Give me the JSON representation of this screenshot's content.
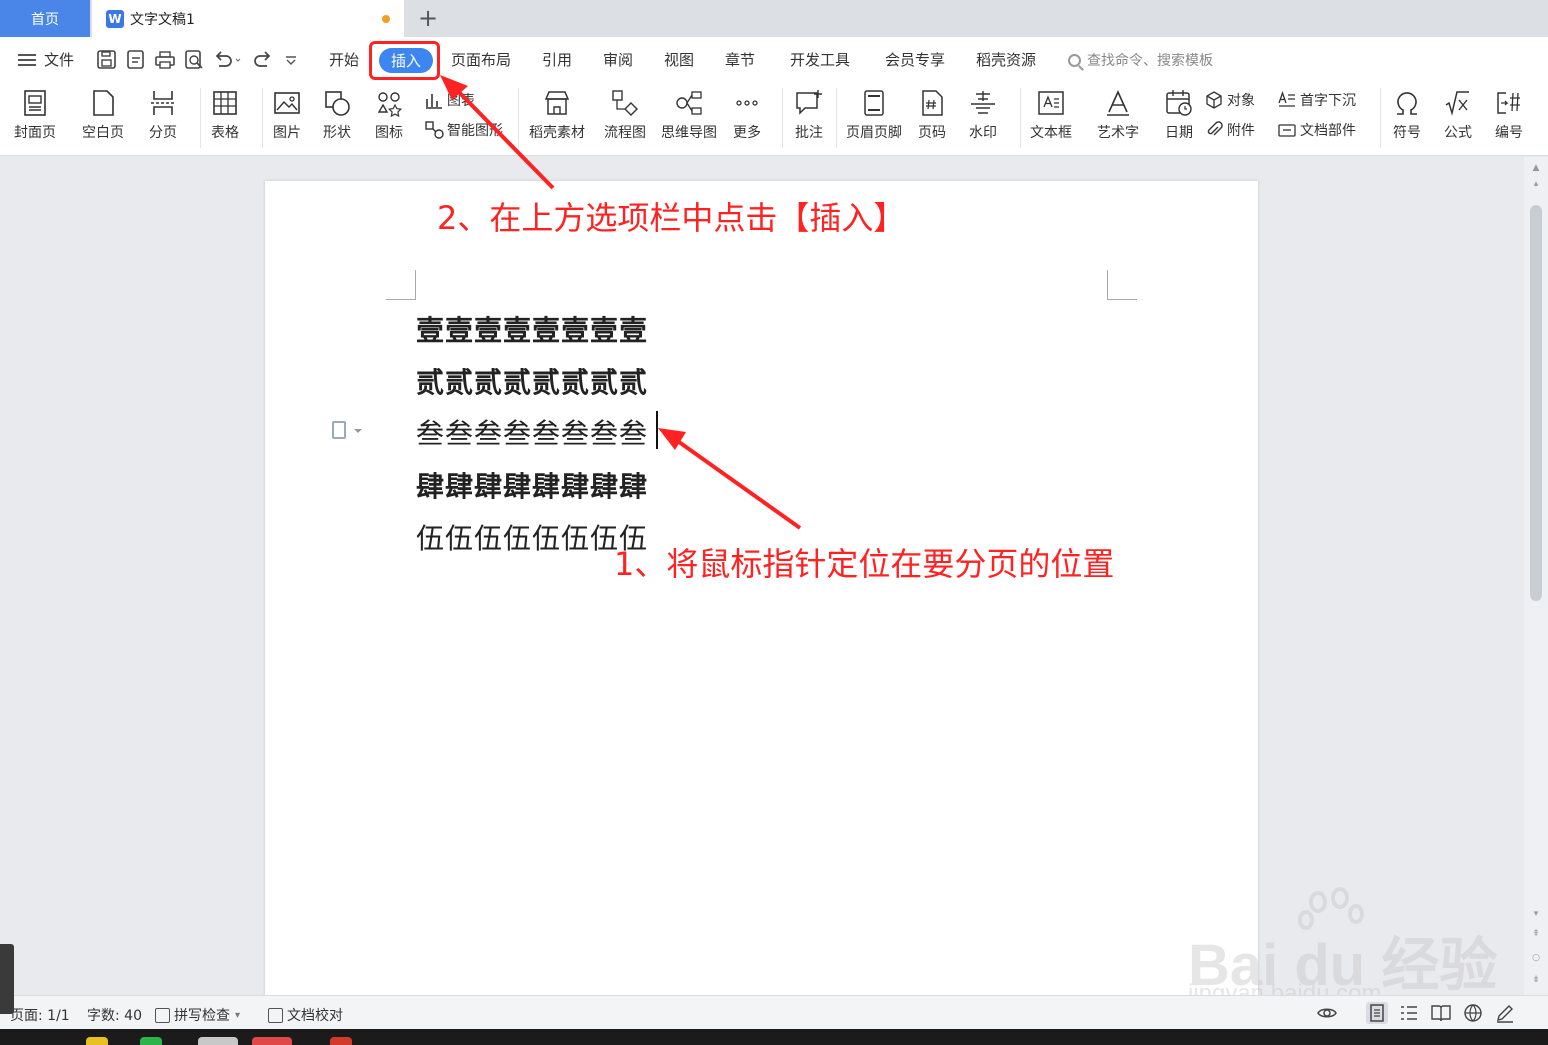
{
  "tabs": {
    "home": "首页",
    "doc": "文字文稿1",
    "add": "+"
  },
  "menu": {
    "file": "文件",
    "tabs": [
      "开始",
      "插入",
      "页面布局",
      "引用",
      "审阅",
      "视图",
      "章节",
      "开发工具",
      "会员专享",
      "稻壳资源"
    ],
    "search_placeholder": "查找命令、搜索模板"
  },
  "ribbon": {
    "cover": "封面页",
    "blank": "空白页",
    "pagebreak": "分页",
    "table": "表格",
    "picture": "图片",
    "shape": "形状",
    "icon": "图标",
    "chart": "图表",
    "smartart": "智能图形",
    "docer": "稻壳素材",
    "flowchart": "流程图",
    "mindmap": "思维导图",
    "more": "更多",
    "comment": "批注",
    "header_footer": "页眉页脚",
    "page_number": "页码",
    "watermark": "水印",
    "textbox": "文本框",
    "wordart": "艺术字",
    "date": "日期",
    "object": "对象",
    "attachment": "附件",
    "dropcap": "首字下沉",
    "docpart": "文档部件",
    "symbol": "符号",
    "formula": "公式",
    "numbering": "编号"
  },
  "document": {
    "lines": [
      "壹壹壹壹壹壹壹壹",
      "贰贰贰贰贰贰贰贰",
      "叁叁叁叁叁叁叁叁",
      "肆肆肆肆肆肆肆肆",
      "伍伍伍伍伍伍伍伍"
    ]
  },
  "annotations": {
    "step2": "2、在上方选项栏中点击【插入】",
    "step1": "1、将鼠标指针定位在要分页的位置"
  },
  "status": {
    "page": "页面: 1/1",
    "words": "字数: 40",
    "spellcheck": "拼写检查",
    "proofread": "文档校对"
  },
  "watermark": {
    "brand": "Bai  du 经验",
    "url": "jingyan.baidu.com"
  },
  "colors": {
    "accent": "#3d86f2",
    "annotation": "#ff2222"
  }
}
